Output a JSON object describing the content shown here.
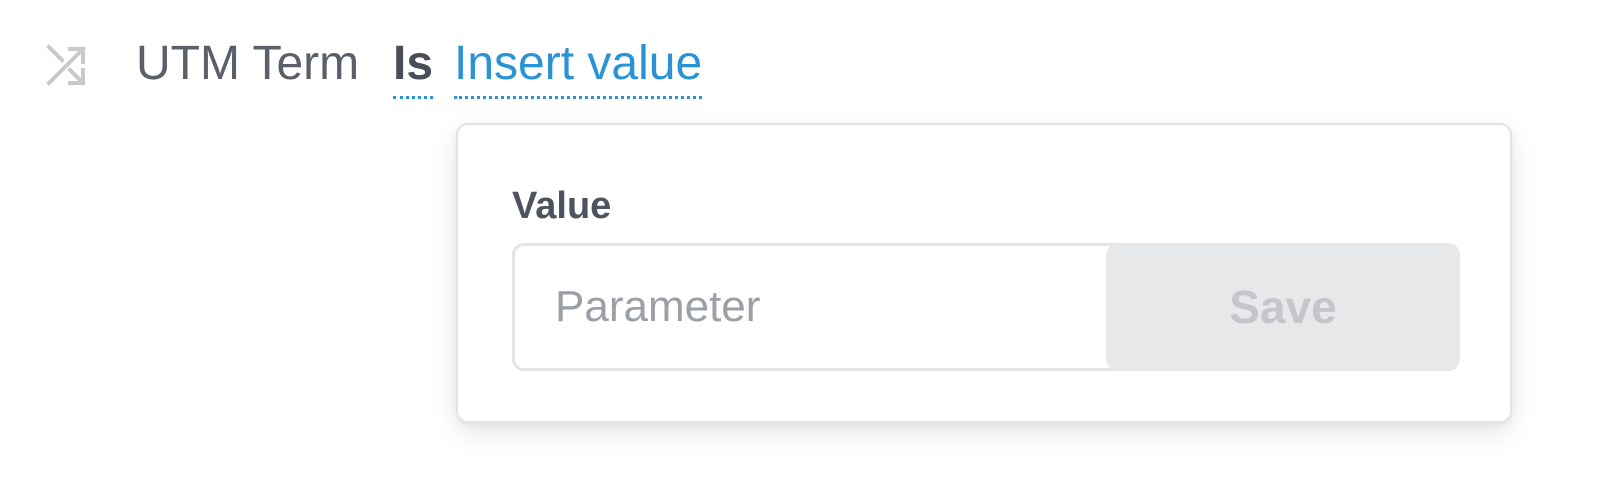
{
  "condition": {
    "icon": "shuffle-icon",
    "field_label": "UTM Term",
    "operator_label": "Is",
    "value_link_label": "Insert value"
  },
  "popover": {
    "label": "Value",
    "input": {
      "value": "",
      "placeholder": "Parameter"
    },
    "save_label": "Save"
  },
  "colors": {
    "link_blue": "#2a93d5",
    "text_dark": "#4a4e59",
    "text_muted": "#5b5f6a",
    "placeholder_gray": "#9b9fa6",
    "disabled_button_bg": "#e7e8ea",
    "disabled_button_text": "#c4c6ca",
    "icon_gray": "#c9c9c9",
    "border_gray": "#e3e4e6"
  }
}
